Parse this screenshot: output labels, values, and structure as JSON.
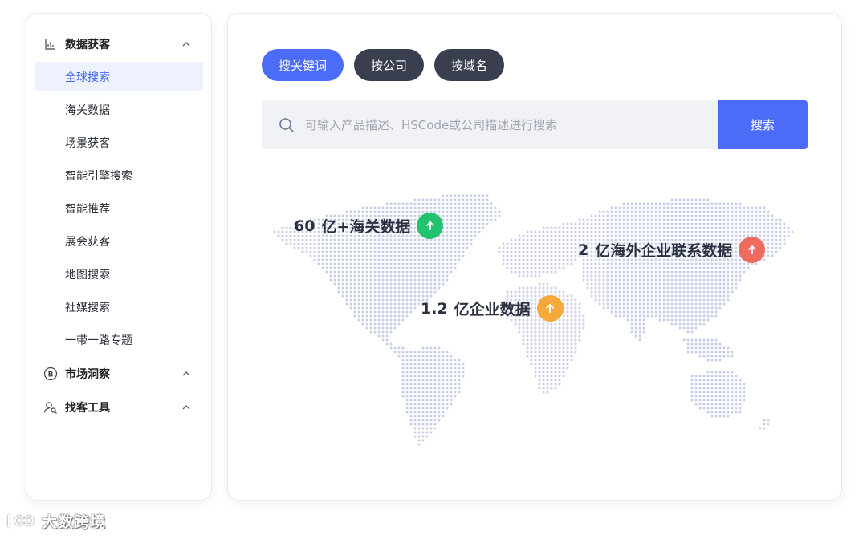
{
  "sidebar": {
    "groups": [
      {
        "label": "数据获客",
        "icon": "bar-chart-icon",
        "expanded": true,
        "items": [
          "全球搜索",
          "海关数据",
          "场景获客",
          "智能引擎搜索",
          "智能推荐",
          "展会获客",
          "地图搜索",
          "社媒搜索",
          "一带一路专题"
        ],
        "active_item": "全球搜索"
      },
      {
        "label": "市场洞察",
        "icon": "b-circle-icon",
        "expanded": false
      },
      {
        "label": "找客工具",
        "icon": "user-search-icon",
        "expanded": false
      }
    ]
  },
  "tabs": [
    {
      "label": "搜关键词",
      "active": true
    },
    {
      "label": "按公司",
      "active": false
    },
    {
      "label": "按域名",
      "active": false
    }
  ],
  "search": {
    "placeholder": "可输入产品描述、HSCode或公司描述进行搜索",
    "button_label": "搜索"
  },
  "stats": [
    {
      "number": "60",
      "text": "亿+海关数据",
      "arrow_color": "#22c26e"
    },
    {
      "number": "2",
      "text": "亿海外企业联系数据",
      "arrow_color": "#f06b5e"
    },
    {
      "number": "1.2",
      "text": "亿企业数据",
      "arrow_color": "#f5a93a"
    }
  ],
  "colors": {
    "accent": "#4b6cf7",
    "dark_tab": "#3a3f4f",
    "map_dot": "#c8d0e8"
  },
  "watermark": "大数跨境"
}
